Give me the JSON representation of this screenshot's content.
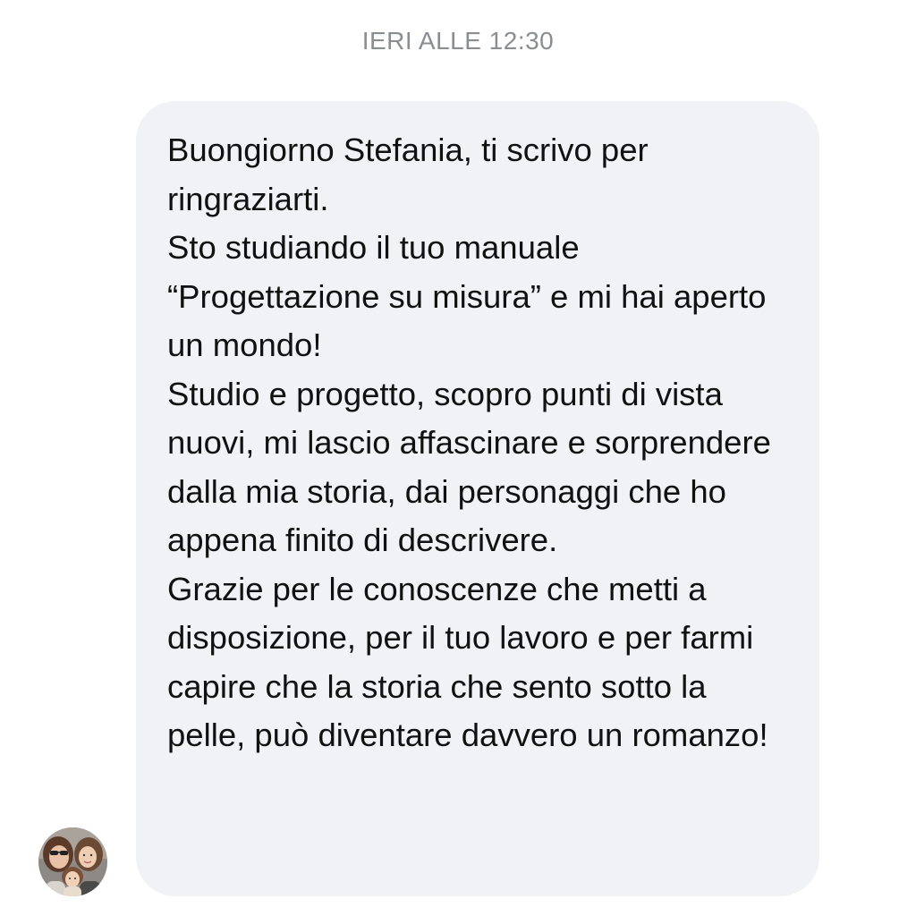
{
  "chat": {
    "timestamp": "IERI ALLE 12:30",
    "message": {
      "paragraphs": [
        "Buongiorno Stefania, ti scrivo per ringraziarti.",
        "Sto studiando il tuo manuale “Progettazione su misura” e mi hai aperto un mondo!",
        "Studio e progetto, scopro punti di vista nuovi, mi lascio affascinare e sorprendere dalla mia storia, dai personaggi che ho appena finito di descrivere.",
        "Grazie per le conoscenze che metti a disposizione, per il tuo lavoro e per farmi capire che la storia che sento sotto la pelle, può diventare davvero un romanzo!"
      ]
    },
    "sender": {
      "avatar_icon": "avatar-icon"
    }
  },
  "colors": {
    "bubble_background": "#f1f2f5",
    "timestamp_text": "#8a8d91",
    "message_text": "#111111"
  }
}
